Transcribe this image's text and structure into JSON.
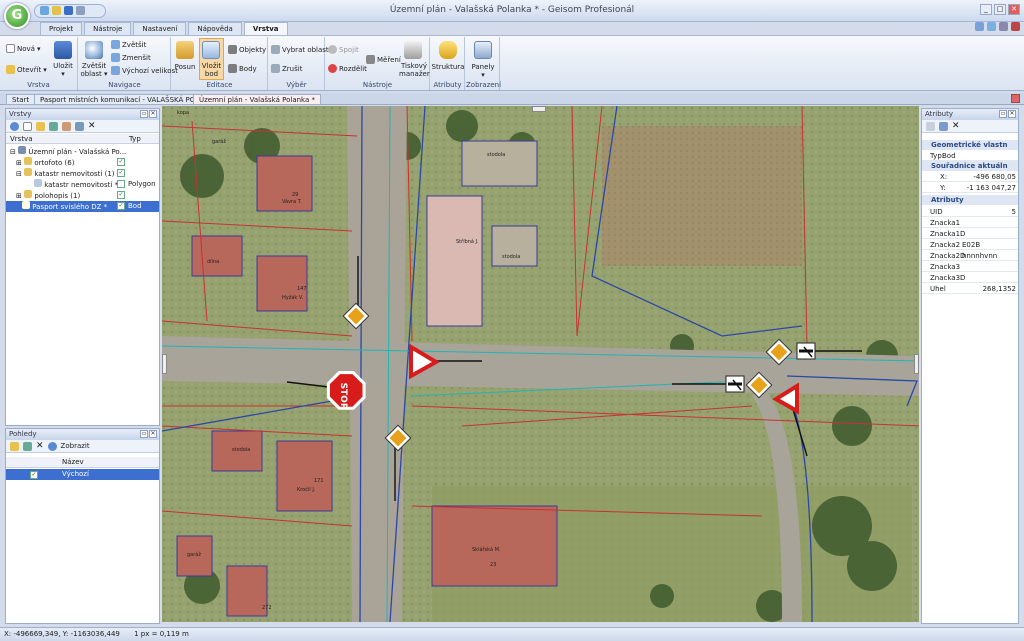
{
  "window": {
    "title": "Územní plán - Valašská Polanka * - Geisom Profesionál"
  },
  "ribbon_tabs": [
    "Projekt",
    "Nástroje",
    "Nastavení",
    "Nápověda",
    "Vrstva"
  ],
  "ribbon": {
    "vrstva_group": {
      "nova": "Nová",
      "otevrit": "Otevřít",
      "ulozit": "Uložit",
      "label": "Vrstva"
    },
    "navigace": {
      "zvetsit": "Zvětšit",
      "zvetsit_oblast": "Zvětšit oblast",
      "zvetsit2": "Zvětšit",
      "zmensit": "Zmenšit",
      "vychozi": "Výchozí velikost",
      "label": "Navigace"
    },
    "editace": {
      "posun": "Posun",
      "vlozit_bod": "Vložit bod",
      "objekty": "Objekty",
      "body": "Body",
      "label": "Editace"
    },
    "vyber": {
      "vybrat_oblast": "Vybrat oblast",
      "zrusit": "Zrušit",
      "label": "Výběr"
    },
    "nastroje": {
      "spojit": "Spojit",
      "rozdelit": "Rozdělit",
      "mereni": "Měření",
      "tiskovy": "Tiskový manažer",
      "label": "Nástroje"
    },
    "atributy": {
      "struktura": "Struktura",
      "label": "Atributy"
    },
    "zobrazeni": {
      "panely": "Panely",
      "label": "Zobrazení"
    }
  },
  "doc_tabs": [
    "Start",
    "Pasport místních komunikací - VALAŠSKÁ POLANKA",
    "Územní plán - Valašská Polanka *"
  ],
  "layers_panel": {
    "title": "Vrstvy",
    "col_name": "Vrstva",
    "col_type": "Typ",
    "rows": [
      {
        "label": "Územní plán - Valašská Po...",
        "type": ""
      },
      {
        "label": "ortofoto (6)",
        "type": ""
      },
      {
        "label": "katastr nemovitostí (1)",
        "type": ""
      },
      {
        "label": "katastr nemovitostí *",
        "type": "Polygon"
      },
      {
        "label": "polohopis (1)",
        "type": ""
      },
      {
        "label": "Pasport svislého DZ *",
        "type": "Bod"
      }
    ]
  },
  "views_panel": {
    "title": "Pohledy",
    "show_btn": "Zobrazit",
    "col": "Název",
    "row": "Výchozí"
  },
  "attr_panel": {
    "title": "Atributy",
    "geo_cat": "Geometrické vlastn",
    "typ_k": "Typ:",
    "typ_v": "Bod",
    "coord_cat": "Souřadnice aktuáln",
    "x_k": "X:",
    "x_v": "-496 680,05",
    "y_k": "Y:",
    "y_v": "-1 163 047,27",
    "attr_cat": "Atributy",
    "rows": [
      {
        "k": "UID",
        "v": "5"
      },
      {
        "k": "Znacka1",
        "v": ""
      },
      {
        "k": "Znacka1D",
        "v": ""
      },
      {
        "k": "Znacka2",
        "v": "E02B"
      },
      {
        "k": "Znacka2D",
        "v": "hnnnhvnn"
      },
      {
        "k": "Znacka3",
        "v": ""
      },
      {
        "k": "Znacka3D",
        "v": ""
      },
      {
        "k": "Uhel",
        "v": "268,1352"
      }
    ]
  },
  "map_labels": {
    "stop": "STOP",
    "parcels": [
      "garáž",
      "Vávra T.",
      "dílna",
      "Hyžák V.",
      "Stříbná J.",
      "stodola",
      "stodola",
      "Kročil J.",
      "stodola",
      "Sklářská M.",
      "garáž",
      "kopa",
      "272",
      "171",
      "23",
      "29",
      "147"
    ]
  },
  "status": {
    "coords": "X: -496669,349, Y: -1163036,449",
    "scale": "1 px = 0,119 m"
  }
}
